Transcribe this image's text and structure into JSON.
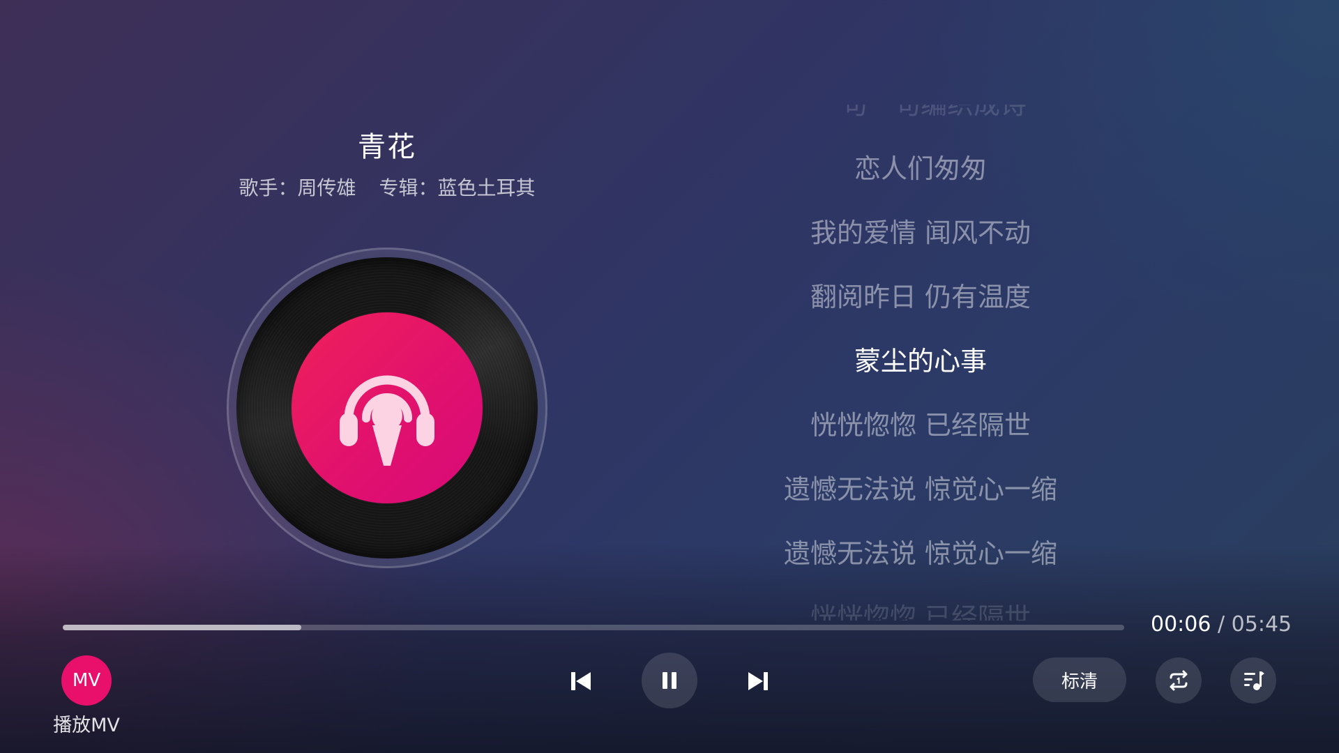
{
  "song": {
    "title": "青花",
    "singer": "歌手：周传雄",
    "album": "专辑：蓝色土耳其"
  },
  "lyrics": {
    "lines": [
      {
        "text": "一句一句编织成诗"
      },
      {
        "text": "恋人们匆匆"
      },
      {
        "text": "我的爱情 闻风不动"
      },
      {
        "text": "翻阅昨日 仍有温度"
      },
      {
        "text": "蒙尘的心事"
      },
      {
        "text": "恍恍惚惚 已经隔世"
      },
      {
        "text": "遗憾无法说 惊觉心一缩"
      },
      {
        "text": "遗憾无法说 惊觉心一缩"
      },
      {
        "text": "恍恍惚惚 已经隔世"
      }
    ],
    "current_line": "蒙尘的心事"
  },
  "player": {
    "current_time": "00:06",
    "separator": "/",
    "total_time": "05:45",
    "progress_fraction": 0.225,
    "mv_badge": "MV",
    "mv_label": "播放MV",
    "quality_label": "标清",
    "state": "playing"
  },
  "icons": {
    "prev": "skip-previous-icon",
    "pause": "pause-icon",
    "next": "skip-next-icon",
    "repeat": "repeat-one-icon",
    "playlist": "playlist-icon",
    "disc_center": "podcast-headphones-icon"
  },
  "colors": {
    "accent": "#e8106a",
    "disc_label": "#e5145f"
  }
}
